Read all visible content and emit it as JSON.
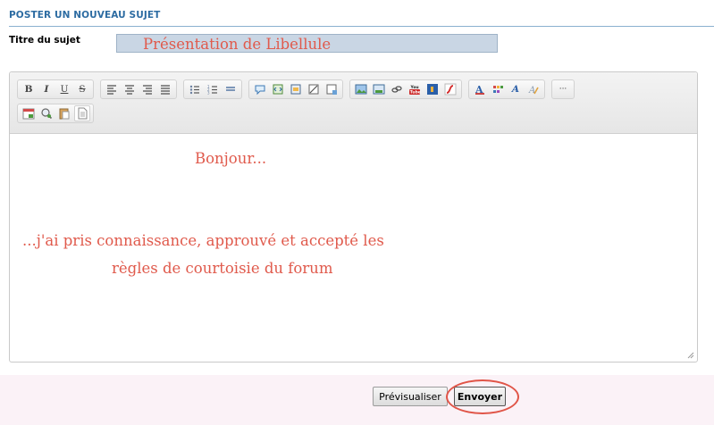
{
  "section": {
    "title": "POSTER UN NOUVEAU SUJET"
  },
  "subject": {
    "label": "Titre du sujet",
    "value": "Présentation de Libellule"
  },
  "toolbar": {
    "row1_groups": [
      [
        "bold-icon",
        "italic-icon",
        "underline-icon",
        "strikethrough-icon"
      ],
      [
        "align-left-icon",
        "align-center-icon",
        "align-right-icon",
        "align-justify-icon"
      ],
      [
        "bulleted-list-icon",
        "numbered-list-icon",
        "horizontal-rule-icon"
      ],
      [
        "quote-icon",
        "code-icon",
        "spoiler-icon",
        "hide-icon",
        "table-icon"
      ],
      [
        "image-icon",
        "upload-image-icon",
        "link-icon",
        "youtube-icon",
        "dailymotion-icon",
        "flash-icon"
      ],
      [
        "font-color-icon",
        "color-palette-icon",
        "font-face-icon",
        "remove-format-icon"
      ],
      [
        "more-icon"
      ]
    ],
    "row2_groups": [
      [
        "date-icon",
        "search-icon",
        "paste-icon",
        "source-mode-icon"
      ]
    ],
    "bold_glyph": "B",
    "italic_glyph": "I",
    "underline_glyph": "U",
    "strike_glyph": "S",
    "fontface_glyph": "A",
    "more_glyph": "···",
    "youtube_glyph": "You Tube"
  },
  "editor": {
    "lines": [
      "Bonjour...",
      "...j'ai pris connaissance, approuvé et accepté les",
      "règles de courtoisie du forum"
    ]
  },
  "actions": {
    "preview_label": "Prévisualiser",
    "send_label": "Envoyer"
  },
  "colors": {
    "accent": "#2d6ca2",
    "message_text": "#e05a4c",
    "highlight": "#e05548",
    "subject_bg": "#c9d6e4",
    "footer_bg": "#fbf2f7"
  }
}
